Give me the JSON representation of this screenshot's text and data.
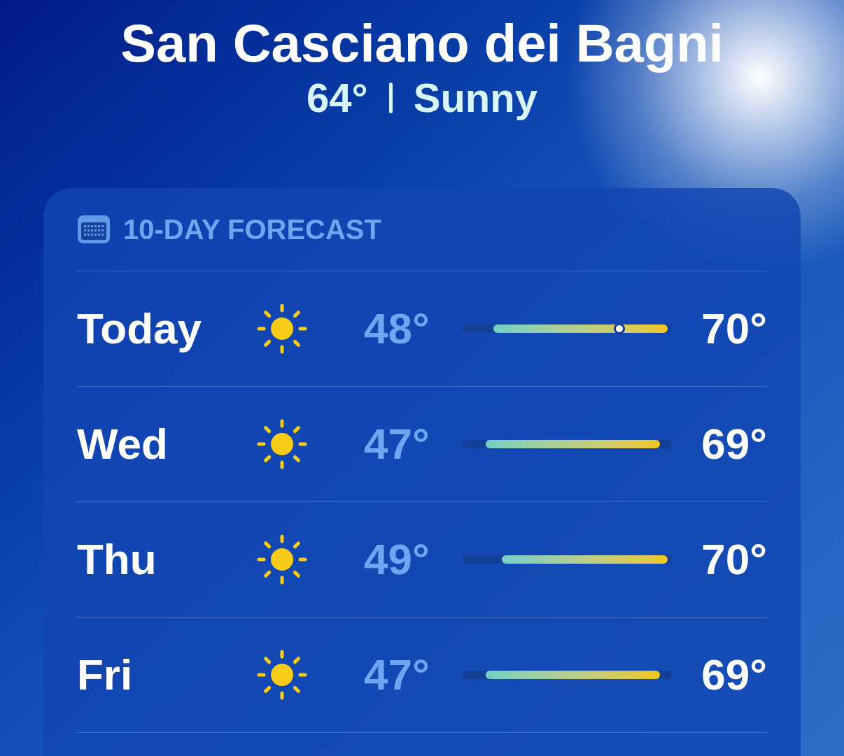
{
  "location": {
    "name": "San Casciano dei Bagni",
    "temperature": "64°",
    "condition": "Sunny"
  },
  "forecast": {
    "title": "10-DAY FORECAST",
    "days": [
      {
        "day": "Today",
        "low": "48°",
        "high": "70°",
        "level": 0.75
      },
      {
        "day": "Wed",
        "low": "47°",
        "high": "69°"
      },
      {
        "day": "Thu",
        "low": "49°",
        "high": "70°"
      },
      {
        "day": "Fri",
        "low": "47°",
        "high": "69°"
      }
    ]
  }
}
